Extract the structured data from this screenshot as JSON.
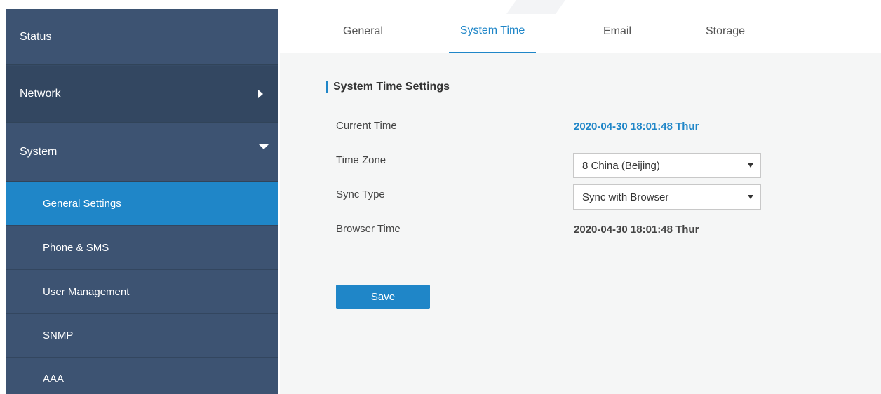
{
  "sidebar": {
    "items": [
      {
        "label": "Status"
      },
      {
        "label": "Network",
        "arrow": "right-arrow-icon"
      },
      {
        "label": "System",
        "arrow": "down-arrow-icon"
      },
      {
        "label": "General Settings",
        "active": true
      },
      {
        "label": "Phone & SMS"
      },
      {
        "label": "User Management"
      },
      {
        "label": "SNMP"
      },
      {
        "label": "AAA"
      }
    ]
  },
  "tabs": [
    {
      "label": "General"
    },
    {
      "label": "System Time",
      "active": true
    },
    {
      "label": "Email"
    },
    {
      "label": "Storage"
    }
  ],
  "section": {
    "title": "System Time Settings"
  },
  "fields": {
    "current_time": {
      "label": "Current Time",
      "value": "2020-04-30 18:01:48 Thur"
    },
    "time_zone": {
      "label": "Time Zone",
      "value": "8 China (Beijing)"
    },
    "sync_type": {
      "label": "Sync Type",
      "value": "Sync with Browser"
    },
    "browser_time": {
      "label": "Browser Time",
      "value": "2020-04-30 18:01:48 Thur"
    }
  },
  "actions": {
    "save_label": "Save"
  },
  "colors": {
    "accent": "#1f86c8",
    "sidebar": "#364b66",
    "panel": "#f5f6f6"
  }
}
